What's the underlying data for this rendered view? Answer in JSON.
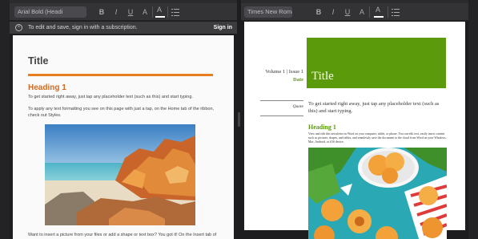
{
  "left_doc": {
    "toolbar": {
      "font_name": "Arial Bold (Headi",
      "bold": "B",
      "italic": "I",
      "underline": "U",
      "font_size_glyph": "A",
      "highlight_glyph": "A"
    },
    "banner": {
      "message": "To edit and save, sign in with a subscription.",
      "sign_in": "Sign in"
    },
    "title": "Title",
    "heading": "Heading 1",
    "para1": "To get started right away, just tap any placeholder text (such as this) and start typing.",
    "para2": "To apply any text formatting you see on this page with just a tap, on the Home tab of the ribbon, check out Styles.",
    "para3": "Want to insert a picture from your files or add a shape or text box? You got it! On the Insert tab of the ribbon, just tap the option you need."
  },
  "right_doc": {
    "toolbar": {
      "font_name": "Times New Roma",
      "bold": "B",
      "italic": "I",
      "underline": "U",
      "font_size_glyph": "A",
      "highlight_glyph": "A"
    },
    "volume": "Volume 1 | Issue 1",
    "date": "Date",
    "title": "Title",
    "quote": "Quote",
    "para1": "To get started right away, just tap any placeholder text (such as this) and start typing.",
    "heading": "Heading 1",
    "para2": "View and edit this newsletter in Word on your computer, tablet, or phone. You can edit text, easily insert content such as pictures, shapes, and tables, and seamlessly save the document to the cloud from Word on your Windows, Mac, Android, or iOS device."
  },
  "colors": {
    "accent_orange": "#e87d1e",
    "accent_green": "#5b9a0b",
    "toolbar_bg": "#333336"
  },
  "icons": [
    "close-circle-icon",
    "bullet-list-icon",
    "split-divider-handle"
  ]
}
